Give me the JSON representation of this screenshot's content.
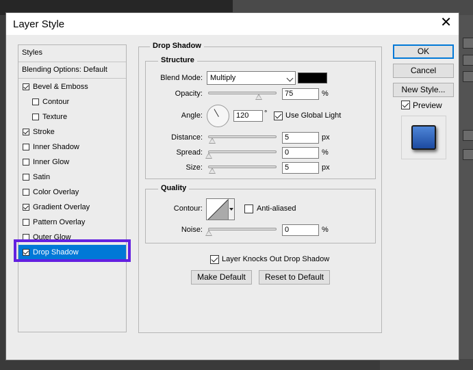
{
  "window": {
    "title": "Layer Style"
  },
  "styles_list": {
    "header": "Styles",
    "blending": "Blending Options: Default",
    "items": [
      {
        "label": "Bevel & Emboss",
        "checked": true
      },
      {
        "label": "Contour",
        "checked": false
      },
      {
        "label": "Texture",
        "checked": false
      },
      {
        "label": "Stroke",
        "checked": true
      },
      {
        "label": "Inner Shadow",
        "checked": false
      },
      {
        "label": "Inner Glow",
        "checked": false
      },
      {
        "label": "Satin",
        "checked": false
      },
      {
        "label": "Color Overlay",
        "checked": false
      },
      {
        "label": "Gradient Overlay",
        "checked": true
      },
      {
        "label": "Pattern Overlay",
        "checked": false
      },
      {
        "label": "Outer Glow",
        "checked": false
      },
      {
        "label": "Drop Shadow",
        "checked": true,
        "selected": true
      }
    ]
  },
  "drop_shadow": {
    "title": "Drop Shadow",
    "structure": {
      "title": "Structure",
      "blend_mode_label": "Blend Mode:",
      "blend_mode": "Multiply",
      "shadow_color": "#000000",
      "opacity_label": "Opacity:",
      "opacity": "75",
      "opacity_unit": "%",
      "angle_label": "Angle:",
      "angle": "120",
      "angle_unit": "°",
      "use_global_light": "Use Global Light",
      "distance_label": "Distance:",
      "distance": "5",
      "distance_unit": "px",
      "spread_label": "Spread:",
      "spread": "0",
      "spread_unit": "%",
      "size_label": "Size:",
      "size": "5",
      "size_unit": "px"
    },
    "quality": {
      "title": "Quality",
      "contour_label": "Contour:",
      "anti_aliased": "Anti-aliased",
      "noise_label": "Noise:",
      "noise": "0",
      "noise_unit": "%"
    },
    "knockout": "Layer Knocks Out Drop Shadow",
    "make_default": "Make Default",
    "reset_default": "Reset to Default"
  },
  "buttons": {
    "ok": "OK",
    "cancel": "Cancel",
    "new_style": "New Style...",
    "preview": "Preview"
  }
}
